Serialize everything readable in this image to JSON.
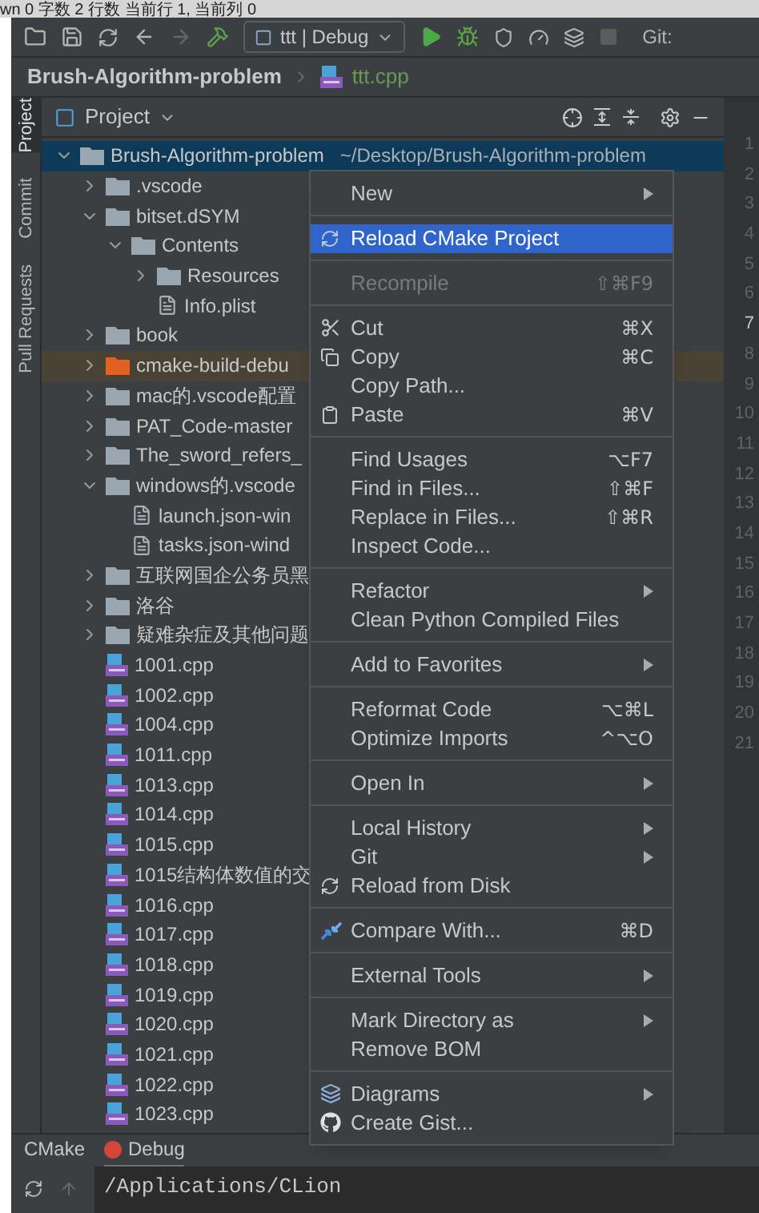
{
  "status_strip": {
    "text": "wn  0 字数  2 行数  当前行 1, 当前列 0"
  },
  "toolbar": {
    "run_config": "ttt | Debug",
    "git_label": "Git:"
  },
  "breadcrumb": {
    "project": "Brush-Algorithm-problem",
    "file": "ttt.cpp"
  },
  "tool_strip": [
    {
      "label": "Project",
      "selected": true
    },
    {
      "label": "Commit",
      "selected": false
    },
    {
      "label": "Pull Requests",
      "selected": false
    }
  ],
  "project_panel": {
    "title": "Project",
    "tree": [
      {
        "label": "Brush-Algorithm-problem",
        "path": "~/Desktop/Brush-Algorithm-problem",
        "kind": "folder",
        "expanded": true,
        "selected": true,
        "excluded": false,
        "children": [
          {
            "label": ".vscode",
            "kind": "folder",
            "expanded": false,
            "selected": false,
            "excluded": false
          },
          {
            "label": "bitset.dSYM",
            "kind": "folder",
            "expanded": true,
            "selected": false,
            "excluded": false,
            "children": [
              {
                "label": "Contents",
                "kind": "folder",
                "expanded": true,
                "selected": false,
                "excluded": false,
                "children": [
                  {
                    "label": "Resources",
                    "kind": "folder",
                    "expanded": false,
                    "selected": false,
                    "excluded": false
                  },
                  {
                    "label": "Info.plist",
                    "kind": "file",
                    "selected": false,
                    "excluded": false
                  }
                ]
              }
            ]
          },
          {
            "label": "book",
            "kind": "folder",
            "expanded": false,
            "selected": false,
            "excluded": false
          },
          {
            "label": "cmake-build-debu",
            "kind": "folder",
            "expanded": false,
            "selected": false,
            "excluded": true
          },
          {
            "label": "mac的.vscode配置",
            "kind": "folder",
            "expanded": false,
            "selected": false,
            "excluded": false
          },
          {
            "label": "PAT_Code-master",
            "kind": "folder",
            "expanded": false,
            "selected": false,
            "excluded": false
          },
          {
            "label": "The_sword_refers_",
            "kind": "folder",
            "expanded": false,
            "selected": false,
            "excluded": false
          },
          {
            "label": "windows的.vscode",
            "kind": "folder",
            "expanded": true,
            "selected": false,
            "excluded": false,
            "children": [
              {
                "label": "launch.json-win",
                "kind": "file",
                "selected": false,
                "excluded": false
              },
              {
                "label": "tasks.json-wind",
                "kind": "file",
                "selected": false,
                "excluded": false
              }
            ]
          },
          {
            "label": "互联网国企公务员黑",
            "kind": "folder",
            "expanded": false,
            "selected": false,
            "excluded": false
          },
          {
            "label": "洛谷",
            "kind": "folder",
            "expanded": false,
            "selected": false,
            "excluded": false
          },
          {
            "label": "疑难杂症及其他问题",
            "kind": "folder",
            "expanded": false,
            "selected": false,
            "excluded": false
          },
          {
            "label": "1001.cpp",
            "kind": "cpp",
            "selected": false,
            "excluded": false
          },
          {
            "label": "1002.cpp",
            "kind": "cpp",
            "selected": false,
            "excluded": false
          },
          {
            "label": "1004.cpp",
            "kind": "cpp",
            "selected": false,
            "excluded": false
          },
          {
            "label": "1011.cpp",
            "kind": "cpp",
            "selected": false,
            "excluded": false
          },
          {
            "label": "1013.cpp",
            "kind": "cpp",
            "selected": false,
            "excluded": false
          },
          {
            "label": "1014.cpp",
            "kind": "cpp",
            "selected": false,
            "excluded": false
          },
          {
            "label": "1015.cpp",
            "kind": "cpp",
            "selected": false,
            "excluded": false
          },
          {
            "label": "1015结构体数值的交",
            "kind": "cpp",
            "selected": false,
            "excluded": false
          },
          {
            "label": "1016.cpp",
            "kind": "cpp",
            "selected": false,
            "excluded": false
          },
          {
            "label": "1017.cpp",
            "kind": "cpp",
            "selected": false,
            "excluded": false
          },
          {
            "label": "1018.cpp",
            "kind": "cpp",
            "selected": false,
            "excluded": false
          },
          {
            "label": "1019.cpp",
            "kind": "cpp",
            "selected": false,
            "excluded": false
          },
          {
            "label": "1020.cpp",
            "kind": "cpp",
            "selected": false,
            "excluded": false
          },
          {
            "label": "1021.cpp",
            "kind": "cpp",
            "selected": false,
            "excluded": false
          },
          {
            "label": "1022.cpp",
            "kind": "cpp",
            "selected": false,
            "excluded": false
          },
          {
            "label": "1023.cpp",
            "kind": "cpp",
            "selected": false,
            "excluded": false
          }
        ]
      }
    ]
  },
  "gutter": {
    "lines": [
      {
        "number": "1",
        "current": false
      },
      {
        "number": "2",
        "current": false
      },
      {
        "number": "3",
        "current": false
      },
      {
        "number": "4",
        "current": false
      },
      {
        "number": "5",
        "current": false
      },
      {
        "number": "6",
        "current": false
      },
      {
        "number": "7",
        "current": true
      },
      {
        "number": "8",
        "current": false
      },
      {
        "number": "9",
        "current": false
      },
      {
        "number": "10",
        "current": false
      },
      {
        "number": "11",
        "current": false
      },
      {
        "number": "12",
        "current": false
      },
      {
        "number": "13",
        "current": false
      },
      {
        "number": "14",
        "current": false
      },
      {
        "number": "15",
        "current": false
      },
      {
        "number": "16",
        "current": false
      },
      {
        "number": "17",
        "current": false
      },
      {
        "number": "18",
        "current": false
      },
      {
        "number": "19",
        "current": false
      },
      {
        "number": "20",
        "current": false
      },
      {
        "number": "21",
        "current": false
      }
    ]
  },
  "context_menu": {
    "groups": [
      {
        "items": [
          {
            "label": "New",
            "submenu": true,
            "disabled": false,
            "selected": false
          }
        ]
      },
      {
        "items": [
          {
            "label": "Reload CMake Project",
            "submenu": false,
            "disabled": false,
            "selected": true
          }
        ]
      },
      {
        "items": [
          {
            "label": "Recompile",
            "shortcut": "⇧⌘F9",
            "submenu": false,
            "disabled": true,
            "selected": false
          }
        ]
      },
      {
        "items": [
          {
            "label": "Cut",
            "shortcut": "⌘X",
            "submenu": false,
            "disabled": false,
            "selected": false
          },
          {
            "label": "Copy",
            "shortcut": "⌘C",
            "submenu": false,
            "disabled": false,
            "selected": false
          },
          {
            "label": "Copy Path...",
            "submenu": false,
            "disabled": false,
            "selected": false
          },
          {
            "label": "Paste",
            "shortcut": "⌘V",
            "submenu": false,
            "disabled": false,
            "selected": false
          }
        ]
      },
      {
        "items": [
          {
            "label": "Find Usages",
            "shortcut": "⌥F7",
            "submenu": false,
            "disabled": false,
            "selected": false
          },
          {
            "label": "Find in Files...",
            "shortcut": "⇧⌘F",
            "submenu": false,
            "disabled": false,
            "selected": false
          },
          {
            "label": "Replace in Files...",
            "shortcut": "⇧⌘R",
            "submenu": false,
            "disabled": false,
            "selected": false
          },
          {
            "label": "Inspect Code...",
            "submenu": false,
            "disabled": false,
            "selected": false
          }
        ]
      },
      {
        "items": [
          {
            "label": "Refactor",
            "submenu": true,
            "disabled": false,
            "selected": false
          },
          {
            "label": "Clean Python Compiled Files",
            "submenu": false,
            "disabled": false,
            "selected": false
          }
        ]
      },
      {
        "items": [
          {
            "label": "Add to Favorites",
            "submenu": true,
            "disabled": false,
            "selected": false
          }
        ]
      },
      {
        "items": [
          {
            "label": "Reformat Code",
            "shortcut": "⌥⌘L",
            "submenu": false,
            "disabled": false,
            "selected": false
          },
          {
            "label": "Optimize Imports",
            "shortcut": "^⌥O",
            "submenu": false,
            "disabled": false,
            "selected": false
          }
        ]
      },
      {
        "items": [
          {
            "label": "Open In",
            "submenu": true,
            "disabled": false,
            "selected": false
          }
        ]
      },
      {
        "items": [
          {
            "label": "Local History",
            "submenu": true,
            "disabled": false,
            "selected": false
          },
          {
            "label": "Git",
            "submenu": true,
            "disabled": false,
            "selected": false
          },
          {
            "label": "Reload from Disk",
            "submenu": false,
            "disabled": false,
            "selected": false
          }
        ]
      },
      {
        "items": [
          {
            "label": "Compare With...",
            "shortcut": "⌘D",
            "submenu": false,
            "disabled": false,
            "selected": false
          }
        ]
      },
      {
        "items": [
          {
            "label": "External Tools",
            "submenu": true,
            "disabled": false,
            "selected": false
          }
        ]
      },
      {
        "items": [
          {
            "label": "Mark Directory as",
            "submenu": true,
            "disabled": false,
            "selected": false
          },
          {
            "label": "Remove BOM",
            "submenu": false,
            "disabled": false,
            "selected": false
          }
        ]
      },
      {
        "items": [
          {
            "label": "Diagrams",
            "submenu": true,
            "disabled": false,
            "selected": false
          },
          {
            "label": "Create Gist...",
            "submenu": false,
            "disabled": false,
            "selected": false
          }
        ]
      }
    ]
  },
  "bottom_tabs": [
    {
      "label": "CMake",
      "selected": false,
      "error": false
    },
    {
      "label": "Debug",
      "selected": true,
      "error": true
    }
  ],
  "console": {
    "line": "/Applications/CLion"
  }
}
